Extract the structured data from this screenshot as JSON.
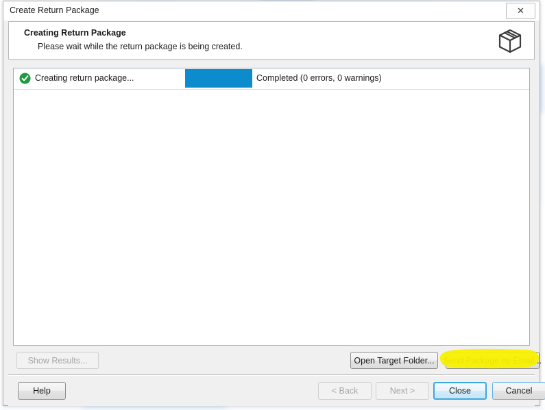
{
  "window": {
    "title": "Create Return Package",
    "close_icon": "close-x-icon",
    "close_label": "✕"
  },
  "header": {
    "title": "Creating Return Package",
    "subtitle": "Please wait while the return package is being created.",
    "icon": "package-box-icon"
  },
  "results": {
    "rows": [
      {
        "status_icon": "green-check-circle-icon",
        "label": "Creating return package...",
        "progress_percent": 100,
        "detail": "Completed (0 errors, 0 warnings)"
      }
    ]
  },
  "actions": {
    "show_results_label": "Show Results...",
    "show_results_enabled": false,
    "open_target_folder_label": "Open Target Folder...",
    "open_target_folder_enabled": true,
    "send_package_email_label": "Send Package by Email...",
    "send_package_email_enabled": true,
    "send_package_email_highlighted": true
  },
  "footer": {
    "help_label": "Help",
    "back_label": "< Back",
    "back_enabled": false,
    "next_label": "Next >",
    "next_enabled": false,
    "close_label": "Close",
    "close_is_default": true,
    "cancel_label": "Cancel"
  },
  "colors": {
    "progress_bar": "#0d8ccd",
    "status_success": "#1a9b3d",
    "highlight_marker": "#f7f000",
    "default_button_border": "#3ba9e0",
    "dialog_background": "#f0f0f0"
  }
}
